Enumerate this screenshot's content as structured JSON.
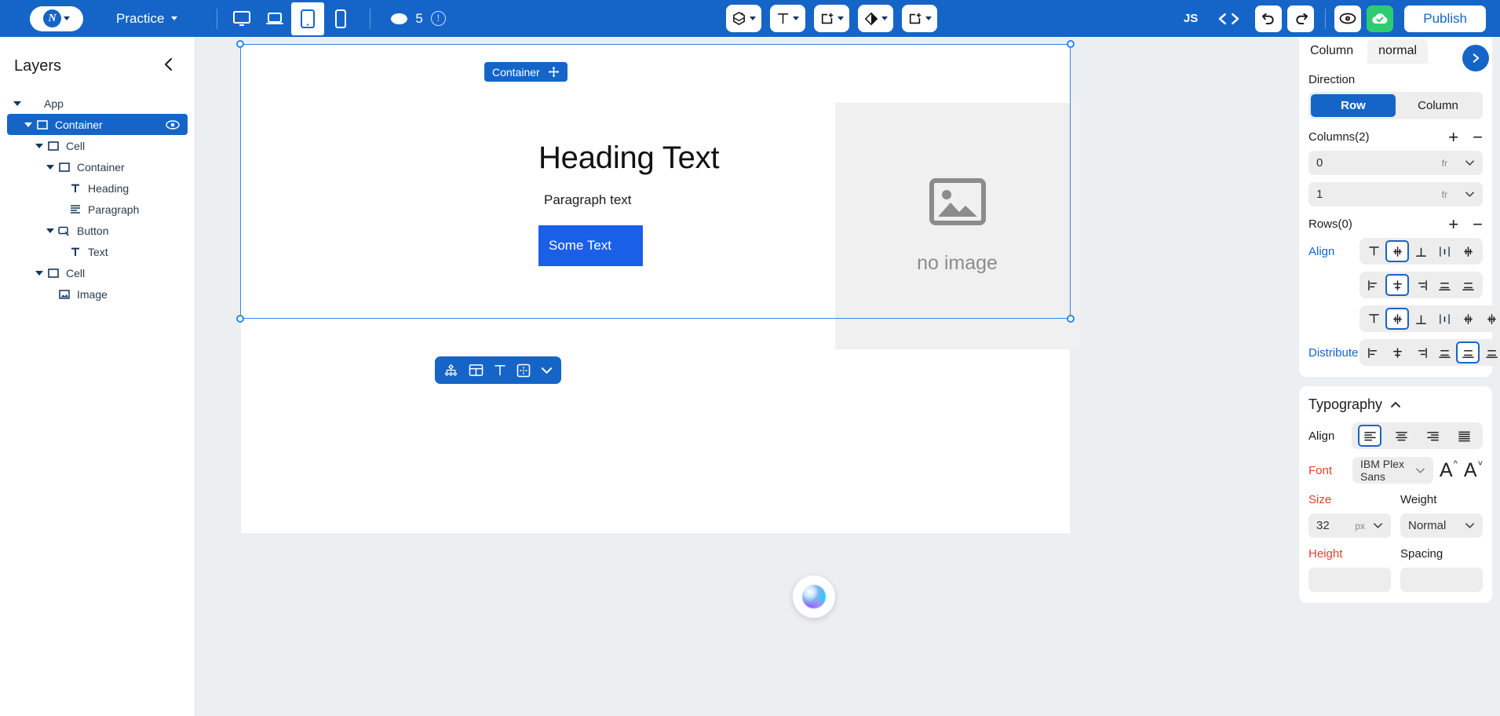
{
  "topbar": {
    "brand_icon": "app-logo-icon",
    "project_name": "Practice",
    "devices": [
      {
        "name": "desktop",
        "icon": "monitor-icon",
        "active": false
      },
      {
        "name": "laptop",
        "icon": "laptop-icon",
        "active": false
      },
      {
        "name": "tablet",
        "icon": "tablet-icon",
        "active": true
      },
      {
        "name": "mobile",
        "icon": "phone-icon",
        "active": false
      }
    ],
    "credits": "5",
    "credits_icon": "coin-icon",
    "info_icon": "info-icon",
    "tools": [
      {
        "name": "component-add",
        "icon": "cube-plus-icon"
      },
      {
        "name": "text-add",
        "icon": "text-t-icon"
      },
      {
        "name": "container-add",
        "icon": "box-plus-icon"
      },
      {
        "name": "shape-add",
        "icon": "diamond-icon"
      },
      {
        "name": "element-add",
        "icon": "box-plus-alt-icon"
      }
    ],
    "js_label": "JS",
    "code_icon": "code-brackets-icon",
    "undo_icon": "undo-icon",
    "redo_icon": "redo-icon",
    "preview_icon": "eye-icon",
    "saved_icon": "cloud-check-icon",
    "publish_label": "Publish"
  },
  "layers": {
    "title": "Layers",
    "collapse_icon": "chevron-left-icon",
    "items": [
      {
        "label": "App",
        "indent": 0,
        "caret": true,
        "icon": "",
        "selected": false,
        "eye": false
      },
      {
        "label": "Container",
        "indent": 1,
        "caret": true,
        "icon": "square-icon",
        "selected": true,
        "eye": true
      },
      {
        "label": "Cell",
        "indent": 2,
        "caret": true,
        "icon": "square-icon",
        "selected": false,
        "eye": false
      },
      {
        "label": "Container",
        "indent": 3,
        "caret": true,
        "icon": "square-icon",
        "selected": false,
        "eye": false
      },
      {
        "label": "Heading",
        "indent": 4,
        "caret": false,
        "icon": "text-t-icon",
        "selected": false,
        "eye": false
      },
      {
        "label": "Paragraph",
        "indent": 4,
        "caret": false,
        "icon": "paragraph-icon",
        "selected": false,
        "eye": false
      },
      {
        "label": "Button",
        "indent": 3,
        "caret": true,
        "icon": "button-icon",
        "selected": false,
        "eye": false
      },
      {
        "label": "Text",
        "indent": 4,
        "caret": false,
        "icon": "text-t-icon",
        "selected": false,
        "eye": false
      },
      {
        "label": "Cell",
        "indent": 2,
        "caret": true,
        "icon": "square-icon",
        "selected": false,
        "eye": false
      },
      {
        "label": "Image",
        "indent": 3,
        "caret": false,
        "icon": "image-icon",
        "selected": false,
        "eye": false
      }
    ]
  },
  "canvas": {
    "selection_tag": "Container",
    "move_icon": "move-arrows-icon",
    "heading": "Heading Text",
    "paragraph": "Paragraph text",
    "button_text": "Some Text",
    "image_caption": "no image",
    "image_icon": "image-placeholder-icon",
    "float_tools": [
      {
        "name": "node-tree-icon"
      },
      {
        "name": "layout-columns-icon"
      },
      {
        "name": "text-t-icon"
      },
      {
        "name": "padding-box-icon"
      },
      {
        "name": "chevron-down-icon"
      }
    ],
    "ai_button": "ai-assistant-orb"
  },
  "inspector": {
    "tabs": [
      {
        "label": "Column",
        "active": true
      },
      {
        "label": "normal",
        "active": false
      }
    ],
    "next_icon": "chevron-right-icon",
    "direction": {
      "label": "Direction",
      "options": [
        "Row",
        "Column"
      ],
      "selected": "Row"
    },
    "columns": {
      "label": "Columns(2)",
      "add_icon": "plus-icon",
      "remove_icon": "minus-icon",
      "tracks": [
        {
          "value": "0",
          "unit": "fr"
        },
        {
          "value": "1",
          "unit": "fr"
        }
      ]
    },
    "rows": {
      "label": "Rows(0)",
      "add_icon": "plus-icon",
      "remove_icon": "minus-icon"
    },
    "align": {
      "label": "Align",
      "vertical": {
        "icons": [
          "align-top-icon",
          "align-middle-icon",
          "align-bottom-icon",
          "align-stretch-v-icon",
          "align-baseline-icon"
        ],
        "selected": 1
      },
      "horizontal": {
        "icons": [
          "align-left-icon",
          "align-center-icon",
          "align-right-icon",
          "align-space-between-icon",
          "align-space-around-icon"
        ],
        "selected": 1
      }
    },
    "distribute": {
      "label": "Distribute",
      "vertical": {
        "icons": [
          "dist-top-icon",
          "dist-middle-icon",
          "dist-bottom-icon",
          "dist-stretch-icon",
          "dist-between-icon",
          "dist-around-icon"
        ],
        "selected": 1
      },
      "horizontal": {
        "icons": [
          "dist-left-icon",
          "dist-center-icon",
          "dist-right-icon",
          "dist-even-icon",
          "dist-between-h-icon",
          "dist-around-h-icon"
        ],
        "selected": 4
      }
    },
    "typography": {
      "title": "Typography",
      "collapse_icon": "chevron-up-icon",
      "align": {
        "label": "Align",
        "icons": [
          "text-align-left-icon",
          "text-align-center-icon",
          "text-align-right-icon",
          "text-align-justify-icon"
        ],
        "selected": 0
      },
      "font": {
        "label": "Font",
        "value": "IBM Plex Sans",
        "dropdown_icon": "chevron-down-icon",
        "increase_icon": "font-increase-icon",
        "decrease_icon": "font-decrease-icon"
      },
      "size": {
        "label": "Size",
        "value": "32",
        "unit": "px"
      },
      "weight": {
        "label": "Weight",
        "value": "Normal"
      },
      "height": {
        "label": "Height"
      },
      "spacing": {
        "label": "Spacing"
      }
    }
  }
}
